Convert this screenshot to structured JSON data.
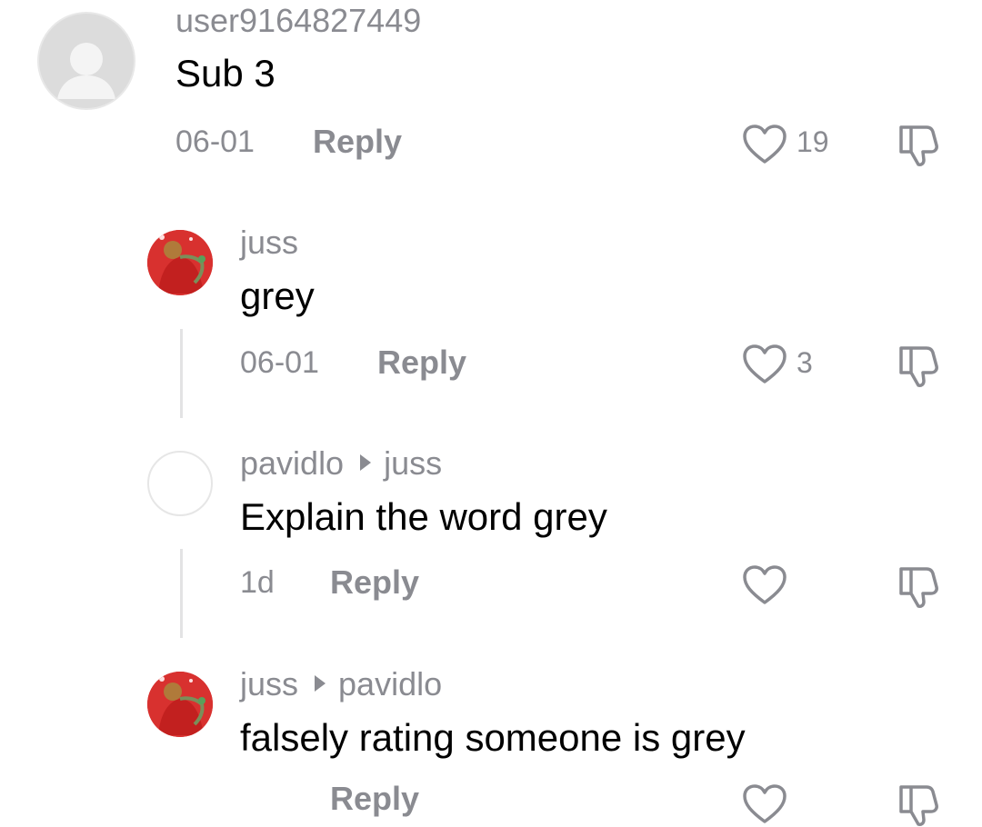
{
  "comments": [
    {
      "username": "user9164827449",
      "text": "Sub 3",
      "date": "06-01",
      "reply_label": "Reply",
      "likes": "19",
      "avatar": "default-avatar"
    },
    {
      "username": "juss",
      "text": "grey",
      "date": "06-01",
      "reply_label": "Reply",
      "likes": "3",
      "avatar": "anime-character-avatar"
    },
    {
      "username": "pavidlo",
      "reply_to": "juss",
      "text": "Explain the word grey",
      "date": "1d",
      "reply_label": "Reply",
      "likes": "",
      "avatar": "blank-avatar"
    },
    {
      "username": "juss",
      "reply_to": "pavidlo",
      "text": "falsely rating someone is grey",
      "date": "",
      "reply_label": "Reply",
      "likes": "",
      "avatar": "anime-character-avatar"
    }
  ],
  "colors": {
    "meta_text": "#8a8b91",
    "avatar_red": "#d8312f",
    "thread_line": "#e3e3e4"
  },
  "icons": {
    "like": "heart-outline-icon",
    "dislike": "thumbs-down-icon",
    "reply_arrow": "caret-right-icon"
  }
}
